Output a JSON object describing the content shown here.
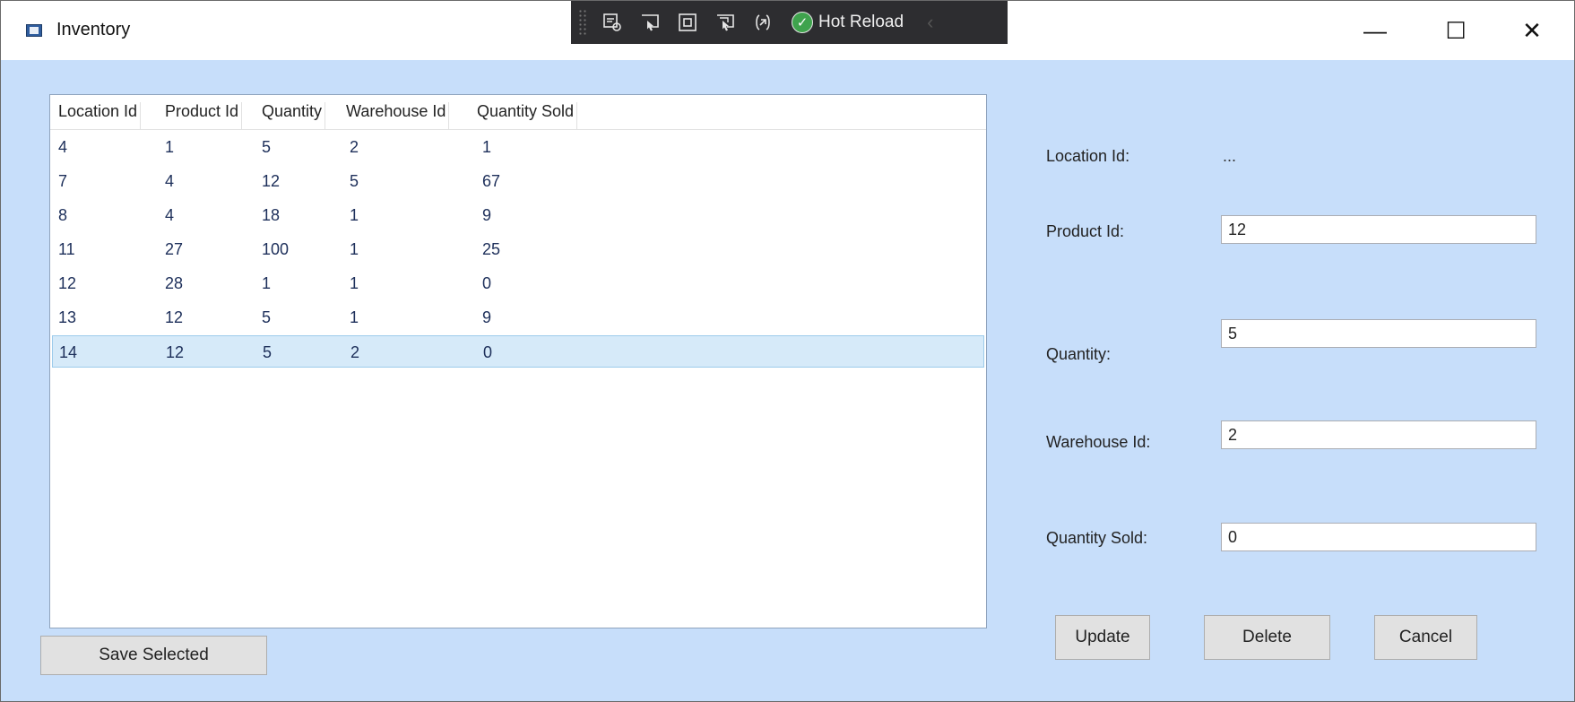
{
  "window": {
    "title": "Inventory",
    "minimize_symbol": "—",
    "maximize_symbol": "☐",
    "close_symbol": "✕"
  },
  "devbar": {
    "hot_reload_label": "Hot Reload",
    "chevron": "‹",
    "icons": [
      "select-element-icon",
      "display-layout-icon",
      "track-focus-icon",
      "preview-selection-icon",
      "binding-failures-icon"
    ]
  },
  "grid": {
    "columns": [
      "Location Id",
      "Product Id",
      "Quantity",
      "Warehouse Id",
      "Quantity Sold"
    ],
    "rows": [
      [
        "4",
        "1",
        "5",
        "2",
        "1"
      ],
      [
        "7",
        "4",
        "12",
        "5",
        "67"
      ],
      [
        "8",
        "4",
        "18",
        "1",
        "9"
      ],
      [
        "11",
        "27",
        "100",
        "1",
        "25"
      ],
      [
        "12",
        "28",
        "1",
        "1",
        "0"
      ],
      [
        "13",
        "12",
        "5",
        "1",
        "9"
      ],
      [
        "14",
        "12",
        "5",
        "2",
        "0"
      ]
    ],
    "selected_row": 6
  },
  "form": {
    "location_label": "Location Id:",
    "location_value": "...",
    "product_label": "Product Id:",
    "product_value": "12",
    "quantity_label": "Quantity:",
    "quantity_value": "5",
    "warehouse_label": "Warehouse Id:",
    "warehouse_value": "2",
    "sold_label": "Quantity Sold:",
    "sold_value": "0"
  },
  "buttons": {
    "save_selected": "Save Selected",
    "update": "Update",
    "delete": "Delete",
    "cancel": "Cancel"
  },
  "colors": {
    "background": "#c7defa",
    "selected_row": "#d6eaf9",
    "hot_reload_ok": "#3fa34d"
  }
}
